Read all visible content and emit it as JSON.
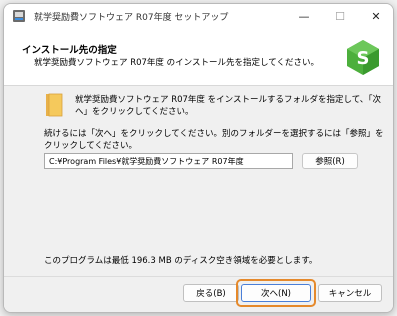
{
  "window": {
    "title": "就学奨励費ソフトウェア R07年度 セットアップ"
  },
  "titlebar": {
    "minimize_glyph": "—",
    "maximize_glyph": "☐",
    "close_glyph": "✕"
  },
  "header": {
    "title": "インストール先の指定",
    "subtitle": "就学奨励費ソフトウェア R07年度 のインストール先を指定してください。"
  },
  "main": {
    "install_message": "就学奨励費ソフトウェア R07年度 をインストールするフォルダを指定して、「次へ」をクリックしてください。",
    "continue_message": "続けるには「次へ」をクリックしてください。別のフォルダーを選択するには「参照」をクリックしてください。",
    "install_path": "C:¥Program Files¥就学奨励費ソフトウェア R07年度",
    "browse_label": "参照(R)",
    "space_message": "このプログラムは最低 196.3 MB のディスク空き領域を必要とします。"
  },
  "footer": {
    "back_label": "戻る(B)",
    "next_label": "次へ(N)",
    "cancel_label": "キャンセル"
  },
  "icons": {
    "app": "installer-app-icon",
    "logo": "green-cube-s-logo-icon",
    "folder": "folder-icon"
  },
  "colors": {
    "highlight": "#e5892b",
    "logo_green": "#4caf3c",
    "folder_yellow": "#f0c14b"
  }
}
